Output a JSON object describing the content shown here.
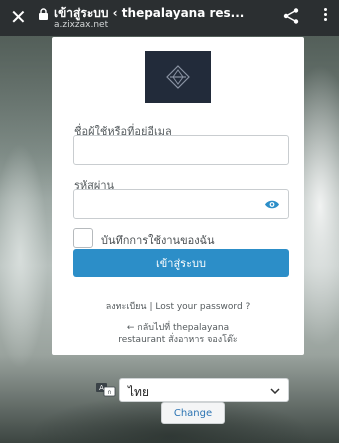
{
  "browser": {
    "page_title": "เข้าสู่ระบบ ‹ thepalayana res...",
    "domain": "a.zixzax.net",
    "close_icon": "close-icon",
    "lock_icon": "lock-icon",
    "share_icon": "share-icon",
    "menu_icon": "more-vert-icon"
  },
  "login": {
    "username_label": "ชื่อผู้ใช้หรือที่อยู่อีเมล",
    "username_value": "",
    "password_label": "รหัสผ่าน",
    "password_value": "",
    "show_password_icon": "eye-icon",
    "remember_label": "บันทึกการใช้งานของฉัน",
    "remember_checked": false,
    "submit_label": "เข้าสู่ระบบ",
    "register_link": "ลงทะเบียน",
    "separator": "|",
    "lost_password_link": "Lost your password ?",
    "back_link_line1": "← กลับไปที่ thepalayana",
    "back_link_line2": "restaurant สั่งอาหาร จองโต๊ะ"
  },
  "language": {
    "icon": "translate-icon",
    "selected": "ไทย",
    "change_label": "Change"
  },
  "colors": {
    "accent": "#2c8ec8",
    "topbar": "#2b2f31",
    "logo_bg": "#222b3a"
  }
}
